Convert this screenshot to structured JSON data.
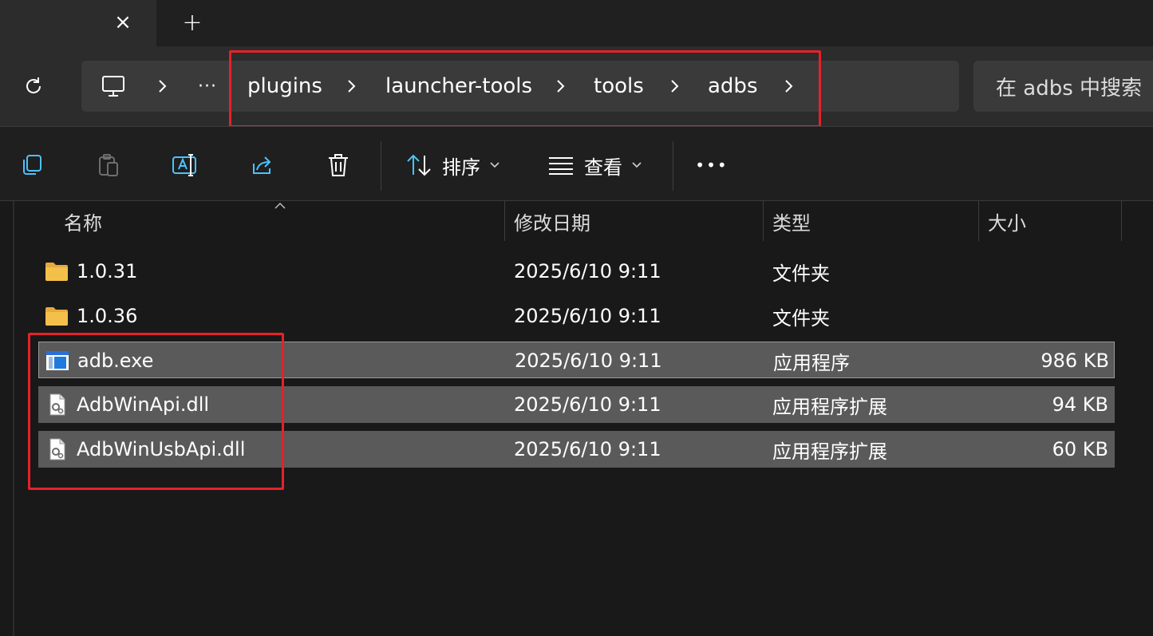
{
  "tabbar": {
    "close_icon": "×",
    "new_tab_icon": "+"
  },
  "navbar": {
    "breadcrumb": {
      "overflow": "···",
      "items": [
        "plugins",
        "launcher-tools",
        "tools",
        "adbs"
      ]
    },
    "search": {
      "placeholder": "在 adbs 中搜索"
    }
  },
  "toolbar": {
    "sort_label": "排序",
    "view_label": "查看",
    "more_label": "•••"
  },
  "columns": {
    "name": "名称",
    "modified": "修改日期",
    "type": "类型",
    "size": "大小"
  },
  "files": [
    {
      "name": "1.0.31",
      "modified": "2025/6/10 9:11",
      "type": "文件夹",
      "size": "",
      "icon": "folder-icon"
    },
    {
      "name": "1.0.36",
      "modified": "2025/6/10 9:11",
      "type": "文件夹",
      "size": "",
      "icon": "folder-icon"
    },
    {
      "name": "adb.exe",
      "modified": "2025/6/10 9:11",
      "type": "应用程序",
      "size": "986 KB",
      "icon": "exe-icon"
    },
    {
      "name": "AdbWinApi.dll",
      "modified": "2025/6/10 9:11",
      "type": "应用程序扩展",
      "size": "94 KB",
      "icon": "dll-icon"
    },
    {
      "name": "AdbWinUsbApi.dll",
      "modified": "2025/6/10 9:11",
      "type": "应用程序扩展",
      "size": "60 KB",
      "icon": "dll-icon"
    }
  ],
  "colors": {
    "background": "#191919",
    "selection": "#5a5a5a",
    "annotation": "#e6212a",
    "folder": "#f3c04a"
  }
}
